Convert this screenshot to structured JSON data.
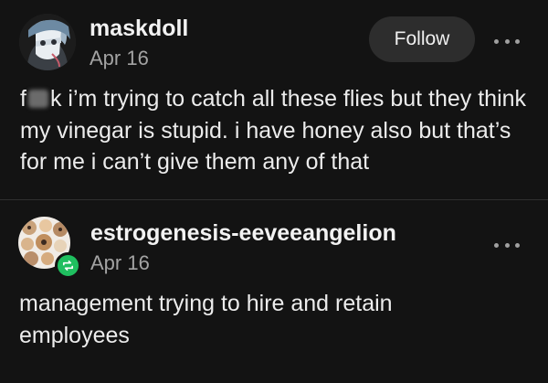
{
  "posts": [
    {
      "username": "maskdoll",
      "date": "Apr 16",
      "follow_label": "Follow",
      "text_prefix": "f",
      "text_censored": "uc",
      "text_rest": "k i’m trying to catch all these flies but they think my vinegar is stupid. i have honey also but that’s for me i can’t give them any of that"
    },
    {
      "username": "estrogenesis-eeveeangelion",
      "date": "Apr 16",
      "text": "management trying to hire and retain employees"
    }
  ],
  "icons": {
    "more": "more-options-icon",
    "reblog": "reblog-icon"
  },
  "colors": {
    "background": "#131313",
    "text": "#ececec",
    "muted": "#a3a3a3",
    "button": "#2d2d2d",
    "reblog_badge": "#1fbf5f"
  }
}
